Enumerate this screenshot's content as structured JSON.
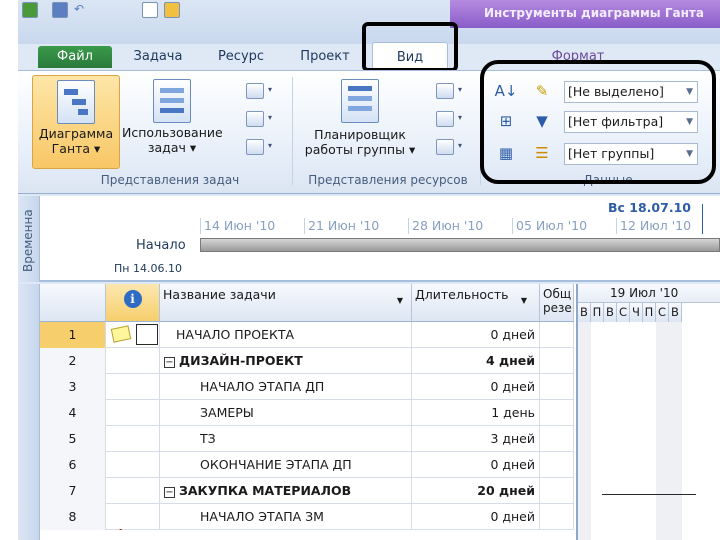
{
  "window": {
    "context_title": "Инструменты диаграммы Ганта"
  },
  "tabs": {
    "file": "Файл",
    "task": "Задача",
    "resource": "Ресурс",
    "project": "Проект",
    "view": "Вид",
    "format": "Формат"
  },
  "ribbon": {
    "task_views": {
      "gantt_label_1": "Диаграмма",
      "gantt_label_2": "Ганта ▾",
      "usage_label_1": "Использование",
      "usage_label_2": "задач ▾",
      "group_label": "Представления задач"
    },
    "resource_views": {
      "planner_label_1": "Планировщик",
      "planner_label_2": "работы группы ▾",
      "group_label": "Представления ресурсов"
    },
    "data": {
      "highlight_value": "[Не выделено]",
      "filter_value": "[Нет фильтра]",
      "group_value": "[Нет группы]",
      "group_label": "Данные"
    }
  },
  "timeline": {
    "vertical_label": "Временна",
    "dates": [
      "14 Июн '10",
      "21 Июн '10",
      "28 Июн '10",
      "05 Июл '10",
      "12 Июл '10"
    ],
    "start_label": "Начало",
    "start_date": "Пн 14.06.10",
    "current_date": "Вс 18.07.10"
  },
  "grid": {
    "headers": {
      "name": "Название задачи",
      "duration": "Длительность",
      "work_1": "Общ",
      "work_2": "резе"
    },
    "rows": [
      {
        "num": "1",
        "name": "НАЧАЛО ПРОЕКТА",
        "duration": "0 дней",
        "indent": 1,
        "summary": false
      },
      {
        "num": "2",
        "name": "ДИЗАЙН-ПРОЕКТ",
        "duration": "4 дней",
        "indent": 0,
        "summary": true
      },
      {
        "num": "3",
        "name": "НАЧАЛО ЭТАПА ДП",
        "duration": "0 дней",
        "indent": 2,
        "summary": false
      },
      {
        "num": "4",
        "name": "ЗАМЕРЫ",
        "duration": "1 день",
        "indent": 2,
        "summary": false
      },
      {
        "num": "5",
        "name": "ТЗ",
        "duration": "3 дней",
        "indent": 2,
        "summary": false
      },
      {
        "num": "6",
        "name": "ОКОНЧАНИЕ ЭТАПА ДП",
        "duration": "0 дней",
        "indent": 2,
        "summary": false
      },
      {
        "num": "7",
        "name": "ЗАКУПКА МАТЕРИАЛОВ",
        "duration": "20 дней",
        "indent": 0,
        "summary": true
      },
      {
        "num": "8",
        "name": "НАЧАЛО ЭТАПА ЗМ",
        "duration": "0 дней",
        "indent": 2,
        "summary": false
      }
    ]
  },
  "chart": {
    "week_label": "19 Июл '10",
    "days": [
      "В",
      "П",
      "В",
      "С",
      "Ч",
      "П",
      "С",
      "В"
    ]
  },
  "colors": {
    "accent": "#2e5da8",
    "file_tab": "#2a7a3a",
    "context_tab": "#8a5cc9",
    "selection": "#f6cf6c"
  }
}
